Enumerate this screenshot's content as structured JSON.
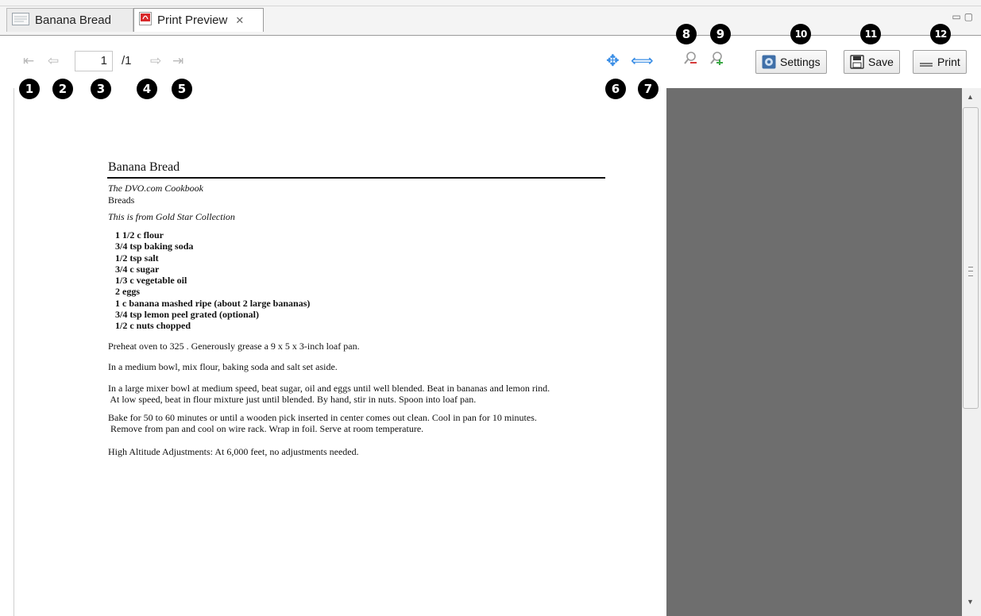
{
  "tabs": [
    {
      "label": "Banana Bread"
    },
    {
      "label": "Print Preview"
    }
  ],
  "toolbar": {
    "page_current": "1",
    "page_total": "/1",
    "settings_label": "Settings",
    "save_label": "Save",
    "print_label": "Print"
  },
  "callouts": [
    "1",
    "2",
    "3",
    "4",
    "5",
    "6",
    "7",
    "8",
    "9",
    "10",
    "11",
    "12"
  ],
  "document": {
    "title": "Banana Bread",
    "cookbook": "The DVO.com Cookbook",
    "category": "Breads",
    "source": "This is from Gold Star Collection",
    "ingredients": [
      "1 1/2 c flour",
      "3/4 tsp baking soda",
      "1/2 tsp salt",
      "3/4 c sugar",
      "1/3 c vegetable oil",
      "2 eggs",
      "1 c banana mashed ripe (about 2 large bananas)",
      "3/4 tsp lemon peel grated (optional)",
      "1/2 c nuts chopped"
    ],
    "paragraphs": [
      "Preheat oven to 325 . Generously grease a 9 x 5 x 3-inch loaf pan.",
      "In a medium bowl, mix flour, baking soda and salt set aside.",
      "In a large mixer bowl at medium speed, beat sugar, oil and eggs until well blended. Beat in bananas and lemon rind.\n At low speed, beat in flour mixture just until blended. By hand, stir in nuts. Spoon into loaf pan.",
      "Bake for 50 to 60 minutes or until a wooden pick inserted in center comes out clean. Cool in pan for 10 minutes.\n Remove from pan and cool on wire rack. Wrap in foil. Serve at room temperature.",
      "High Altitude Adjustments: At 6,000 feet, no adjustments needed."
    ]
  },
  "icons": {
    "first_page": "first-page-icon",
    "prev_page": "previous-page-icon",
    "next_page": "next-page-icon",
    "last_page": "last-page-icon",
    "fit_page": "fit-page-icon",
    "fit_width": "fit-width-icon",
    "zoom_out": "zoom-out-icon",
    "zoom_in": "zoom-in-icon"
  },
  "colors": {
    "accent_blue": "#3a8ee6",
    "pdf_red": "#d8282a",
    "preview_background": "#6e6e6e"
  }
}
